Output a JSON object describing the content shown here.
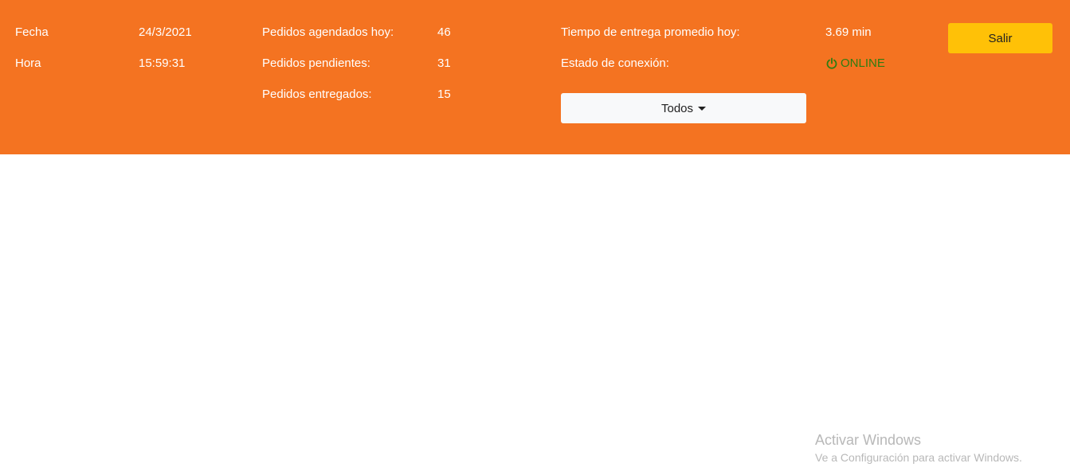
{
  "header": {
    "fecha_label": "Fecha",
    "fecha_value": "24/3/2021",
    "hora_label": "Hora",
    "hora_value": "15:59:31",
    "agendados_label": "Pedidos agendados hoy:",
    "agendados_value": "46",
    "pendientes_label": "Pedidos pendientes:",
    "pendientes_value": "31",
    "entregados_label": "Pedidos entregados:",
    "entregados_value": "15",
    "tiempo_label": "Tiempo de entrega promedio hoy:",
    "tiempo_value": "3.69 min",
    "estado_label": "Estado de conexión:",
    "estado_value": "ONLINE",
    "estado_icon": "power-icon",
    "filter_label": "Todos",
    "salir_label": "Salir"
  },
  "watermark": {
    "title": "Activar Windows",
    "subtitle": "Ve a Configuración para activar Windows."
  },
  "colors": {
    "header_bg": "#f47321",
    "salir_bg": "#ffc107",
    "online": "#2e7d12",
    "filter_bg": "#f8f9fa"
  }
}
